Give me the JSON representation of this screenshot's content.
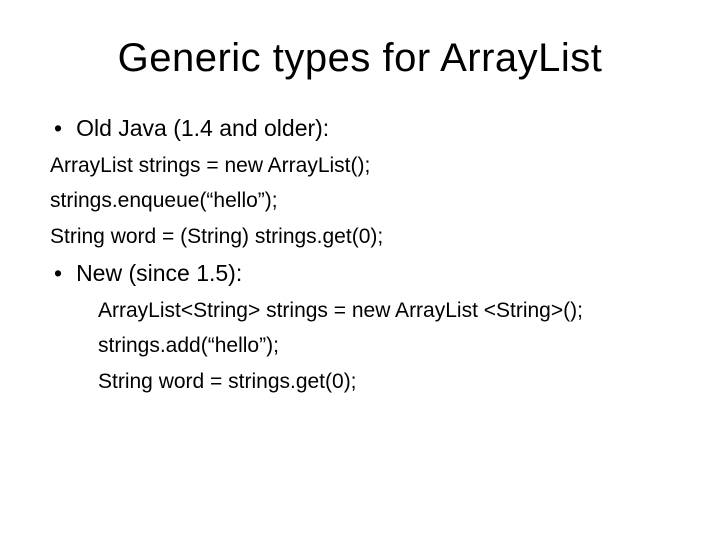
{
  "slide": {
    "title": "Generic types for ArrayList",
    "bullet1": "Old Java (1.4 and older):",
    "line1": "ArrayList strings = new ArrayList();",
    "line2": "strings.enqueue(“hello”);",
    "line3": "String word = (String) strings.get(0);",
    "bullet2": "New (since 1.5):",
    "line4": "ArrayList<String> strings = new ArrayList <String>();",
    "line5": "strings.add(“hello”);",
    "line6": "String word = strings.get(0);"
  }
}
